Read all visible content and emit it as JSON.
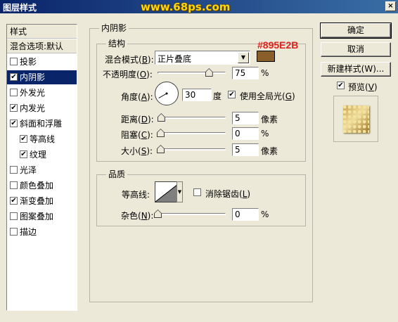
{
  "window": {
    "title": "图层样式",
    "watermark": "www.68ps.com",
    "close_label": "×"
  },
  "styles_list": {
    "header": "样式",
    "blend_options": "混合选项:默认",
    "items": [
      {
        "label": "投影",
        "checked": false,
        "selected": false
      },
      {
        "label": "内阴影",
        "checked": true,
        "selected": true
      },
      {
        "label": "外发光",
        "checked": false,
        "selected": false
      },
      {
        "label": "内发光",
        "checked": true,
        "selected": false
      },
      {
        "label": "斜面和浮雕",
        "checked": true,
        "selected": false
      },
      {
        "label": "等高线",
        "checked": true,
        "selected": false,
        "sub": true
      },
      {
        "label": "纹理",
        "checked": true,
        "selected": false,
        "sub": true
      },
      {
        "label": "光泽",
        "checked": false,
        "selected": false
      },
      {
        "label": "颜色叠加",
        "checked": false,
        "selected": false
      },
      {
        "label": "渐变叠加",
        "checked": true,
        "selected": false
      },
      {
        "label": "图案叠加",
        "checked": false,
        "selected": false
      },
      {
        "label": "描边",
        "checked": false,
        "selected": false
      }
    ]
  },
  "inner_shadow": {
    "title": "内阴影",
    "structure": {
      "title": "结构",
      "blend_mode_label": "混合模式(",
      "blend_mode_key": "B",
      "blend_mode_value": "正片叠底",
      "color_hex": "#895E2B",
      "color": "#895e2b",
      "opacity_label": "不透明度(",
      "opacity_key": "O",
      "opacity_value": "75",
      "opacity_fraction": 0.75,
      "opacity_unit": "%",
      "angle_label": "角度(",
      "angle_key": "A",
      "angle_value": "30",
      "angle_degrees": 30,
      "angle_unit": "度",
      "global_light_label": "使用全局光(",
      "global_light_key": "G",
      "global_light_checked": true,
      "distance_label": "距离(",
      "distance_key": "D",
      "distance_value": "5",
      "distance_fraction": 0.05,
      "distance_unit": "像素",
      "choke_label": "阻塞(",
      "choke_key": "C",
      "choke_value": "0",
      "choke_fraction": 0,
      "choke_unit": "%",
      "size_label": "大小(",
      "size_key": "S",
      "size_value": "5",
      "size_fraction": 0.04,
      "size_unit": "像素"
    },
    "quality": {
      "title": "品质",
      "contour_label": "等高线:",
      "anti_alias_label": "消除锯齿(",
      "anti_alias_key": "L",
      "anti_alias_checked": false,
      "noise_label": "杂色(",
      "noise_key": "N",
      "noise_value": "0",
      "noise_fraction": 0,
      "noise_unit": "%"
    }
  },
  "buttons": {
    "ok": "确定",
    "cancel": "取消",
    "new_style": "新建样式(W)...",
    "preview_label": "预览(",
    "preview_key": "V",
    "preview_checked": true
  },
  "colors": {
    "title_bar_start": "#0a246a",
    "title_bar_end": "#3a6ea5",
    "dialog_bg": "#ece9d8",
    "selection": "#0a246a"
  }
}
